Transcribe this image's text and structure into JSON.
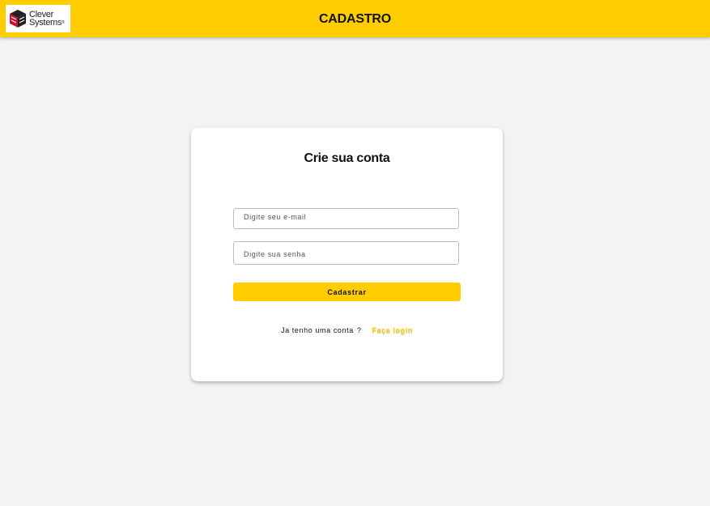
{
  "header": {
    "title": "CADASTRO",
    "logo": {
      "line1": "Clever",
      "line2": "Systems",
      "mark": "®",
      "icon": "cube-icon"
    }
  },
  "card": {
    "title": "Crie sua conta",
    "email": {
      "placeholder": "Digite seu e-mail",
      "value": ""
    },
    "password": {
      "placeholder": "Digite sua senha",
      "value": ""
    },
    "submit_label": "Cadastrar",
    "login_prompt": "Ja tenho uma conta",
    "login_question_mark": "?",
    "login_link": "Faça login"
  },
  "colors": {
    "accent": "#ffcd00",
    "background": "#f2f3f5",
    "card": "#ffffff",
    "logo_red": "#c8102e"
  }
}
